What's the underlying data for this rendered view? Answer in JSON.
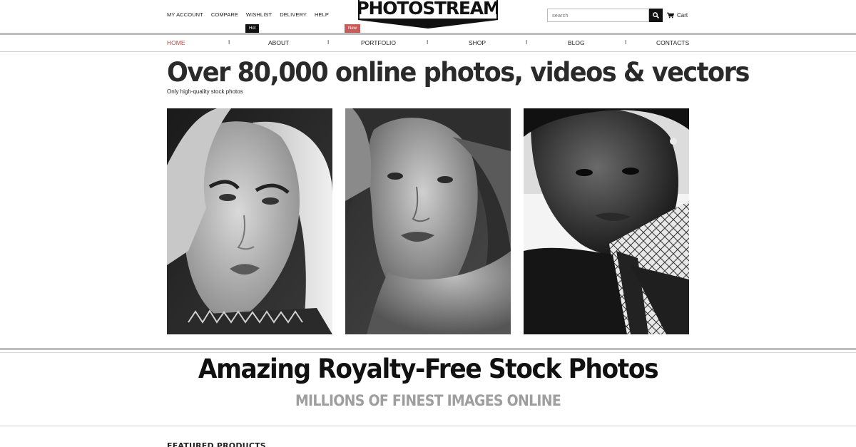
{
  "header": {
    "top_links": [
      "MY ACCOUNT",
      "COMPARE",
      "WISHLIST",
      "DELIVERY",
      "HELP"
    ],
    "logo_text": "PHOTOSTREAM",
    "search": {
      "placeholder": "search",
      "icon": "search-icon"
    },
    "cart_label": "Cart",
    "cart_icon": "cart-icon"
  },
  "nav": {
    "items": [
      {
        "label": "HOME",
        "active": true
      },
      {
        "label": "ABOUT",
        "badge": "Hot"
      },
      {
        "label": "PORTFOLIO",
        "badge": "New"
      },
      {
        "label": "SHOP"
      },
      {
        "label": "BLOG"
      },
      {
        "label": "CONTACTS"
      }
    ],
    "separator": "I",
    "active_color": "#c0473e",
    "badge_colors": {
      "hot": "#111111",
      "new": "#c75b5b"
    }
  },
  "hero": {
    "title": "Over 80,000 online photos, videos & vectors",
    "subtitle": "Only high-quality stock photos",
    "photos": [
      "portrait-woman-blonde",
      "portrait-woman-brunette",
      "portrait-man"
    ]
  },
  "banner": {
    "title": "Amazing Royalty-Free Stock Photos",
    "subtitle": "MILLIONS OF FINEST IMAGES ONLINE"
  },
  "featured": {
    "heading": "FEATURED PRODUCTS"
  }
}
